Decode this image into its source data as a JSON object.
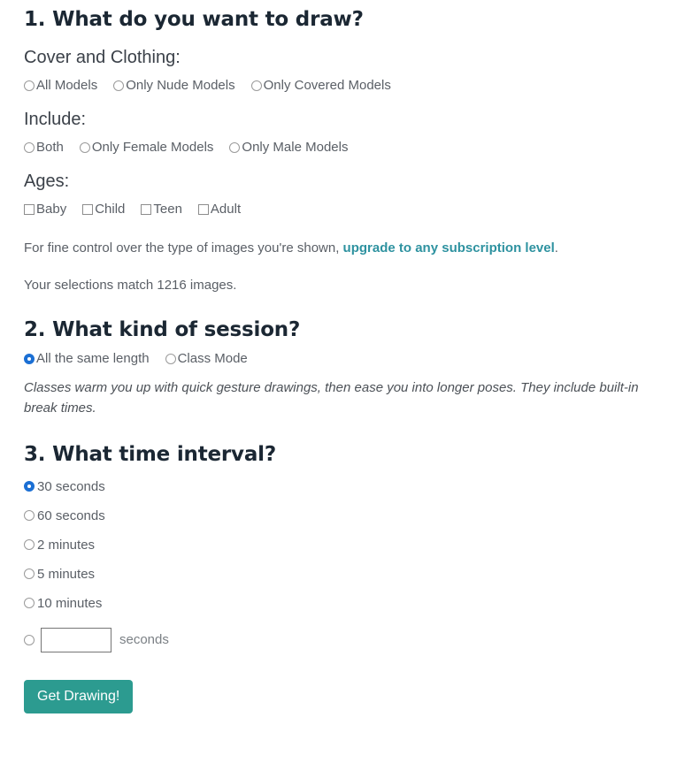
{
  "section1": {
    "title": "1. What do you want to draw?",
    "cover_group": {
      "label": "Cover and Clothing:",
      "options": [
        {
          "label": "All Models",
          "selected": false
        },
        {
          "label": "Only Nude Models",
          "selected": false
        },
        {
          "label": "Only Covered Models",
          "selected": false
        }
      ]
    },
    "include_group": {
      "label": "Include:",
      "options": [
        {
          "label": "Both",
          "selected": false
        },
        {
          "label": "Only Female Models",
          "selected": false
        },
        {
          "label": "Only Male Models",
          "selected": false
        }
      ]
    },
    "ages_group": {
      "label": "Ages:",
      "options": [
        {
          "label": "Baby",
          "checked": false
        },
        {
          "label": "Child",
          "checked": false
        },
        {
          "label": "Teen",
          "checked": false
        },
        {
          "label": "Adult",
          "checked": false
        }
      ]
    },
    "upgrade_note_prefix": "For fine control over the type of images you're shown, ",
    "upgrade_link_text": "upgrade to any subscription level",
    "upgrade_note_suffix": ".",
    "match_note": "Your selections match 1216 images."
  },
  "section2": {
    "title": "2. What kind of session?",
    "options": [
      {
        "label": "All the same length",
        "selected": true
      },
      {
        "label": "Class Mode",
        "selected": false
      }
    ],
    "description": "Classes warm you up with quick gesture drawings, then ease you into longer poses. They include built-in break times."
  },
  "section3": {
    "title": "3. What time interval?",
    "options": [
      {
        "label": "30 seconds",
        "selected": true
      },
      {
        "label": "60 seconds",
        "selected": false
      },
      {
        "label": "2 minutes",
        "selected": false
      },
      {
        "label": "5 minutes",
        "selected": false
      },
      {
        "label": "10 minutes",
        "selected": false
      }
    ],
    "custom": {
      "selected": false,
      "value": "",
      "placeholder": "",
      "unit_label": "seconds"
    }
  },
  "submit": {
    "label": "Get Drawing!"
  },
  "colors": {
    "accent_teal": "#2c9b90",
    "link_teal": "#2e92a0",
    "radio_selected_blue": "#1b6fd4",
    "heading": "#1b2733",
    "body_text": "#5a5f66"
  }
}
